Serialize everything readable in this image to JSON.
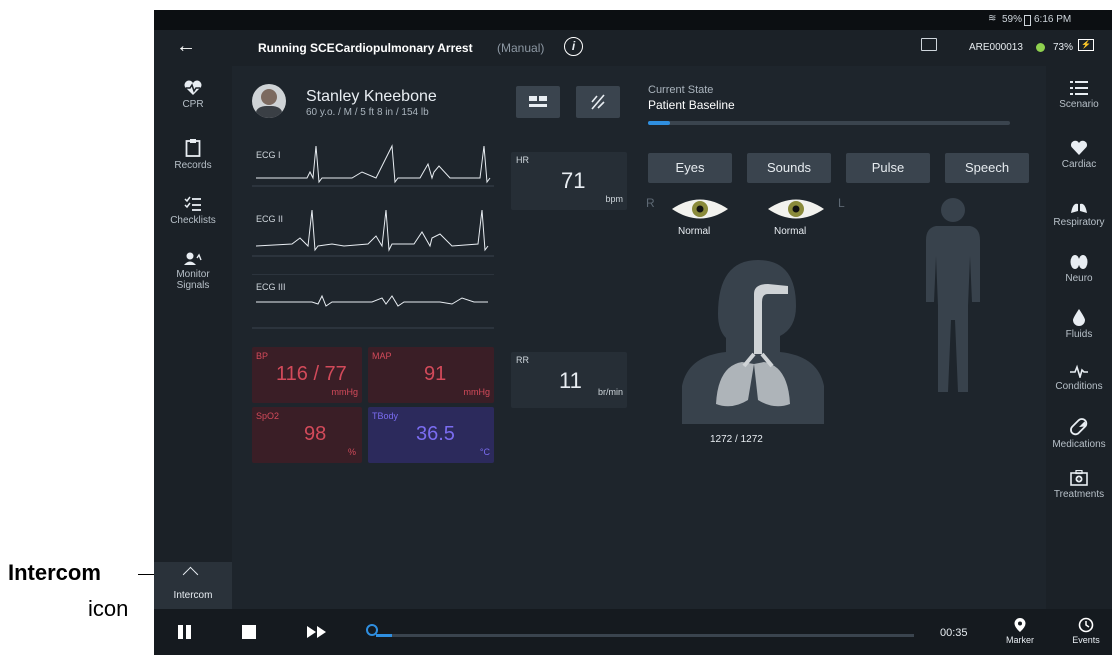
{
  "status_bar": {
    "battery": "59%",
    "time": "6:16 PM"
  },
  "top_bar": {
    "title_running": "Running SCE",
    "title_scenario": "Cardiopulmonary Arrest",
    "title_mode": "(Manual)",
    "device_id": "ARE000013",
    "battery": "73%"
  },
  "left_nav": {
    "items": [
      {
        "label": "CPR",
        "icon": "heart-pulse-icon"
      },
      {
        "label": "Records",
        "icon": "clipboard-icon"
      },
      {
        "label": "Checklists",
        "icon": "checklist-icon"
      },
      {
        "label": "Monitor Signals",
        "icon": "user-signal-icon"
      }
    ],
    "intercom_label": "Intercom"
  },
  "patient": {
    "name": "Stanley Kneebone",
    "details": "60 y.o. / M / 5 ft 8 in / 154 lb"
  },
  "ecg": {
    "lead1": "ECG I",
    "lead2": "ECG II",
    "lead3": "ECG III"
  },
  "vitals": {
    "hr_label": "HR",
    "hr_value": "71",
    "hr_unit": "bpm",
    "rr_label": "RR",
    "rr_value": "11",
    "rr_unit": "br/min",
    "bp_label": "BP",
    "bp_value": "116 / 77",
    "bp_unit": "mmHg",
    "map_label": "MAP",
    "map_value": "91",
    "map_unit": "mmHg",
    "spo2_label": "SpO2",
    "spo2_value": "98",
    "spo2_unit": "%",
    "tbody_label": "TBody",
    "tbody_value": "36.5",
    "tbody_unit": "°C"
  },
  "state": {
    "label": "Current State",
    "value": "Patient Baseline",
    "progress": 0.06
  },
  "tabs": [
    "Eyes",
    "Sounds",
    "Pulse",
    "Speech"
  ],
  "eyes": {
    "right_label": "R",
    "left_label": "L",
    "right_status": "Normal",
    "left_status": "Normal"
  },
  "lungs_readout": "1272 / 1272",
  "right_nav": {
    "items": [
      {
        "label": "Scenario",
        "icon": "list-icon"
      },
      {
        "label": "Cardiac",
        "icon": "heart-icon"
      },
      {
        "label": "Respiratory",
        "icon": "lungs-icon"
      },
      {
        "label": "Neuro",
        "icon": "brain-icon"
      },
      {
        "label": "Fluids",
        "icon": "drop-icon"
      },
      {
        "label": "Conditions",
        "icon": "pulse-line-icon"
      },
      {
        "label": "Medications",
        "icon": "pill-icon"
      },
      {
        "label": "Treatments",
        "icon": "kit-icon"
      }
    ]
  },
  "bottom_bar": {
    "time": "00:35",
    "marker_label": "Marker",
    "events_label": "Events",
    "timeline_progress": 0.03
  },
  "callout": {
    "title": "Intercom",
    "subtitle": "icon"
  },
  "colors": {
    "bp": "#d24a5a",
    "map": "#d24a5a",
    "spo2": "#d24a5a",
    "tbody": "#7a6cf0",
    "accent": "#2f8fe0",
    "status_green": "#8fd14f"
  }
}
